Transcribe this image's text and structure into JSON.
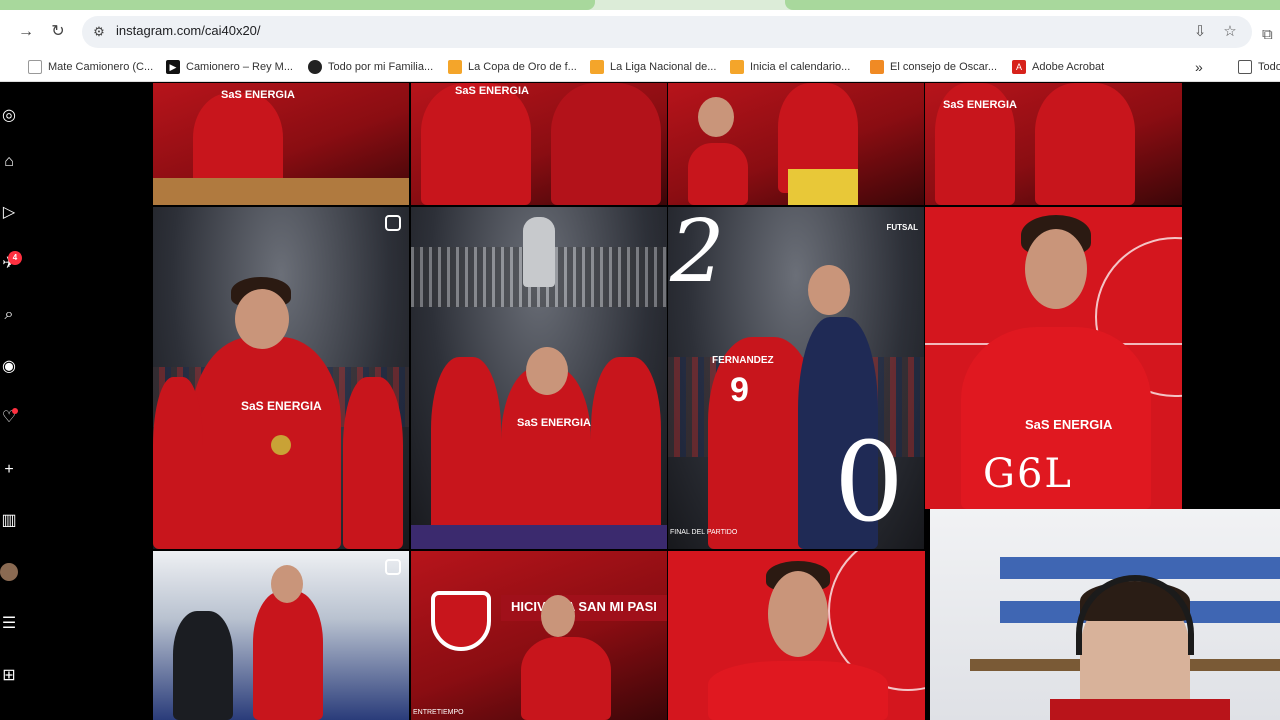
{
  "browser": {
    "url": "instagram.com/cai40x20/",
    "bookmarks": [
      {
        "label": "Mate Camionero (C...",
        "color": "#ffffff",
        "icon": "page-icon"
      },
      {
        "label": "Camionero – Rey M...",
        "color": "#111111",
        "icon": "video-icon"
      },
      {
        "label": "Todo por mi Familia...",
        "color": "#222222",
        "icon": "disc-icon"
      },
      {
        "label": "La Copa de Oro de f...",
        "color": "#f4a52a",
        "icon": "image-icon"
      },
      {
        "label": "La Liga Nacional de...",
        "color": "#f4a52a",
        "icon": "image-icon"
      },
      {
        "label": "Inicia el calendario...",
        "color": "#f4a52a",
        "icon": "image-icon"
      },
      {
        "label": "El consejo de Oscar...",
        "color": "#f08a24",
        "icon": "bookmark-icon"
      },
      {
        "label": "Adobe Acrobat",
        "color": "#d7221b",
        "icon": "acrobat-icon"
      },
      {
        "label": "Todo",
        "color": "#ffffff",
        "icon": "folder-icon"
      }
    ]
  },
  "instagram": {
    "notification_count": "4",
    "tiles": {
      "futsal_tag": "FUTSAL",
      "score_home": "2",
      "score_away": "0",
      "final_caption": "FINAL DEL PARTIDO",
      "player_name": "FERNANDEZ",
      "player_number": "9",
      "gol_text": "G6L",
      "sponsor": "SaS ENERGIA",
      "banner_text": "HICIVE LA SAN MI PASI",
      "entretiempo": "ENTRETIEMPO"
    }
  },
  "colors": {
    "independiente_red": "#d4161e",
    "instagram_badge": "#ff3040"
  }
}
